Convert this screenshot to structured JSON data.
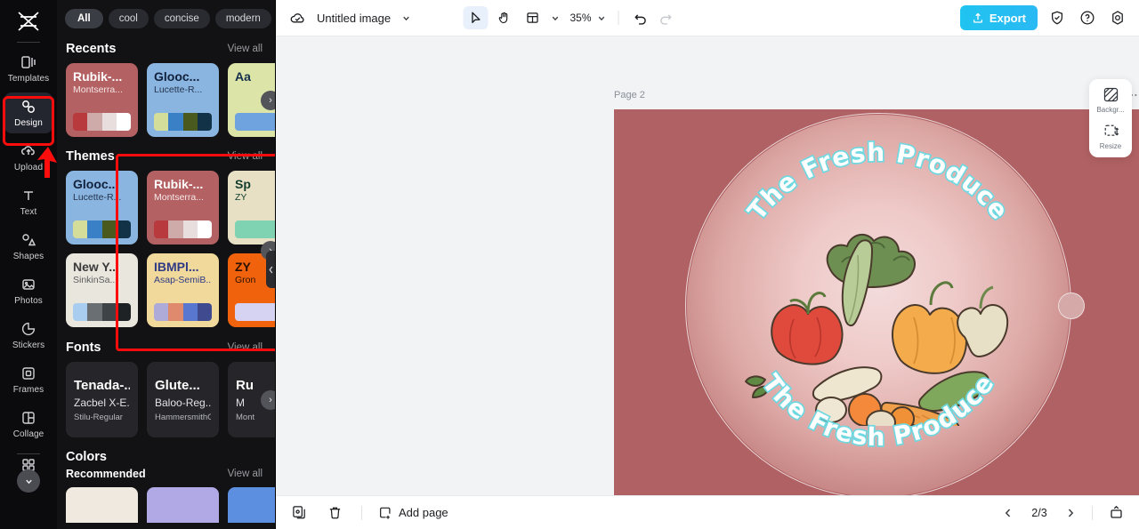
{
  "rail": {
    "logo_icon": "capcut-logo-icon",
    "items": [
      {
        "label": "Templates",
        "icon": "templates-icon"
      },
      {
        "label": "Design",
        "icon": "design-icon",
        "active": true
      },
      {
        "label": "Upload",
        "icon": "upload-cloud-icon"
      },
      {
        "label": "Text",
        "icon": "text-icon"
      },
      {
        "label": "Shapes",
        "icon": "shapes-icon"
      },
      {
        "label": "Photos",
        "icon": "photos-icon"
      },
      {
        "label": "Stickers",
        "icon": "stickers-icon"
      },
      {
        "label": "Frames",
        "icon": "frames-icon"
      },
      {
        "label": "Collage",
        "icon": "collage-icon"
      }
    ],
    "more_icon": "apps-grid-icon",
    "expand_icon": "chevron-down-icon"
  },
  "panel": {
    "chips": [
      {
        "label": "All",
        "selected": true
      },
      {
        "label": "cool",
        "selected": false
      },
      {
        "label": "concise",
        "selected": false
      },
      {
        "label": "modern",
        "selected": false
      }
    ],
    "chip_more_icon": "chevron-down-icon",
    "view_all": "View all",
    "sections": {
      "recents": {
        "title": "Recents",
        "view_all": "View all",
        "cards": [
          {
            "title": "Rubik-...",
            "subtitle": "Montserra...",
            "bg": "#b36163",
            "title_color": "#ffffff",
            "sub_color": "#f4e3e3",
            "swatches": [
              "#b83a3d",
              "#ceaaa9",
              "#e8dedd",
              "#ffffff"
            ]
          },
          {
            "title": "Glooc...",
            "subtitle": "Lucette-R...",
            "bg": "#8ab5e0",
            "title_color": "#11213c",
            "sub_color": "#25354f",
            "swatches": [
              "#d4de9a",
              "#3a80c6",
              "#4a5a1f",
              "#123347"
            ]
          },
          {
            "title": "Aa",
            "subtitle": "",
            "bg": "#dde4a8",
            "title_color": "#13304c",
            "sub_color": "#13304c",
            "swatches": [
              "#6ea3e0",
              "#6ea3e0",
              "#6ea3e0",
              "#6ea3e0"
            ]
          }
        ]
      },
      "themes": {
        "title": "Themes",
        "view_all": "View all",
        "cards": [
          {
            "title": "Glooc...",
            "subtitle": "Lucette-R...",
            "bg": "#8ab5e0",
            "title_color": "#11213c",
            "sub_color": "#25354f",
            "swatches": [
              "#d4de9a",
              "#3a80c6",
              "#4a5a1f",
              "#123347"
            ]
          },
          {
            "title": "Rubik-...",
            "subtitle": "Montserra...",
            "bg": "#b36163",
            "title_color": "#ffffff",
            "sub_color": "#f7e9e9",
            "swatches": [
              "#b83a3d",
              "#ceaaa9",
              "#e8dedd",
              "#ffffff"
            ]
          },
          {
            "title": "Sp",
            "subtitle": "ZY",
            "bg": "#e8e0c4",
            "title_color": "#123d2e",
            "sub_color": "#123d2e",
            "swatches": [
              "#7fd3b2",
              "#7fd3b2",
              "#7fd3b2",
              "#7fd3b2"
            ]
          },
          {
            "title": "New Y...",
            "subtitle": "SinkinSa...",
            "bg": "#e9e6de",
            "title_color": "#3b3b3b",
            "sub_color": "#5c5c5c",
            "swatches": [
              "#a9cdee",
              "#6a6f73",
              "#3e4347",
              "#1f2225"
            ]
          },
          {
            "title": "IBMPl...",
            "subtitle": "Asap-SemiB...",
            "bg": "#f0d99b",
            "title_color": "#2f3a86",
            "sub_color": "#2f3a86",
            "swatches": [
              "#aeabd9",
              "#e08a6d",
              "#5a77cf",
              "#3f4b8e"
            ]
          },
          {
            "title": "ZY",
            "subtitle": "Gron",
            "bg": "#f0620c",
            "title_color": "#2a1100",
            "sub_color": "#2a1100",
            "swatches": [
              "#d6d2f2",
              "#d6d2f2",
              "#d6d2f2",
              "#d6d2f2"
            ]
          }
        ]
      },
      "fonts": {
        "title": "Fonts",
        "view_all": "View all",
        "cards": [
          {
            "line1": "Tenada-...",
            "line2": "Zacbel X-E...",
            "line3": "Stilu-Regular"
          },
          {
            "line1": "Glute...",
            "line2": "Baloo-Reg...",
            "line3": "HammersmithOn..."
          },
          {
            "line1": "Ru",
            "line2": "M",
            "line3": "Mont"
          }
        ]
      },
      "colors": {
        "title": "Colors",
        "recommended_title": "Recommended",
        "view_all": "View all",
        "swatch_cards": [
          "#efe9e0",
          "#b0a9e6",
          "#5d8fe0"
        ]
      }
    },
    "next_arrow_icon": "chevron-right-icon",
    "collapse_icon": "chevron-left-icon"
  },
  "topbar": {
    "cloud_icon": "cloud-saved-icon",
    "doc_title": "Untitled image",
    "title_caret_icon": "chevron-down-icon",
    "tools": [
      {
        "name": "select-tool",
        "icon": "cursor-icon",
        "active": true
      },
      {
        "name": "hand-tool",
        "icon": "hand-icon",
        "active": false
      },
      {
        "name": "layout-tool",
        "icon": "layout-icon",
        "active": false
      }
    ],
    "layout_caret_icon": "chevron-down-icon",
    "zoom_level": "35%",
    "zoom_caret_icon": "chevron-down-icon",
    "undo_icon": "undo-icon",
    "redo_icon": "redo-icon",
    "export_label": "Export",
    "export_icon": "export-upload-icon",
    "export_color": "#23bdf2",
    "shield_icon": "shield-icon",
    "help_icon": "help-circle-icon",
    "settings_icon": "settings-gear-icon"
  },
  "canvas": {
    "page_label": "Page 2",
    "duplicate_icon": "duplicate-page-icon",
    "more_icon": "more-horizontal-icon",
    "background_color": "#b06163",
    "artwork": {
      "top_arc_text": "The Fresh Produce",
      "bottom_arc_text": "The Fresh Produce",
      "text_fill": "#ffffff",
      "text_outline": "#6fd8e0"
    }
  },
  "right_panel": {
    "items": [
      {
        "label": "Backgr...",
        "icon": "background-icon"
      },
      {
        "label": "Resize",
        "icon": "resize-icon"
      }
    ]
  },
  "bottombar": {
    "duplicate_icon": "duplicate-icon",
    "delete_icon": "trash-icon",
    "add_page_label": "Add page",
    "add_page_icon": "add-page-icon",
    "prev_icon": "chevron-left-icon",
    "next_icon": "chevron-right-icon",
    "page_indicator": "2/3",
    "present_icon": "present-icon"
  }
}
